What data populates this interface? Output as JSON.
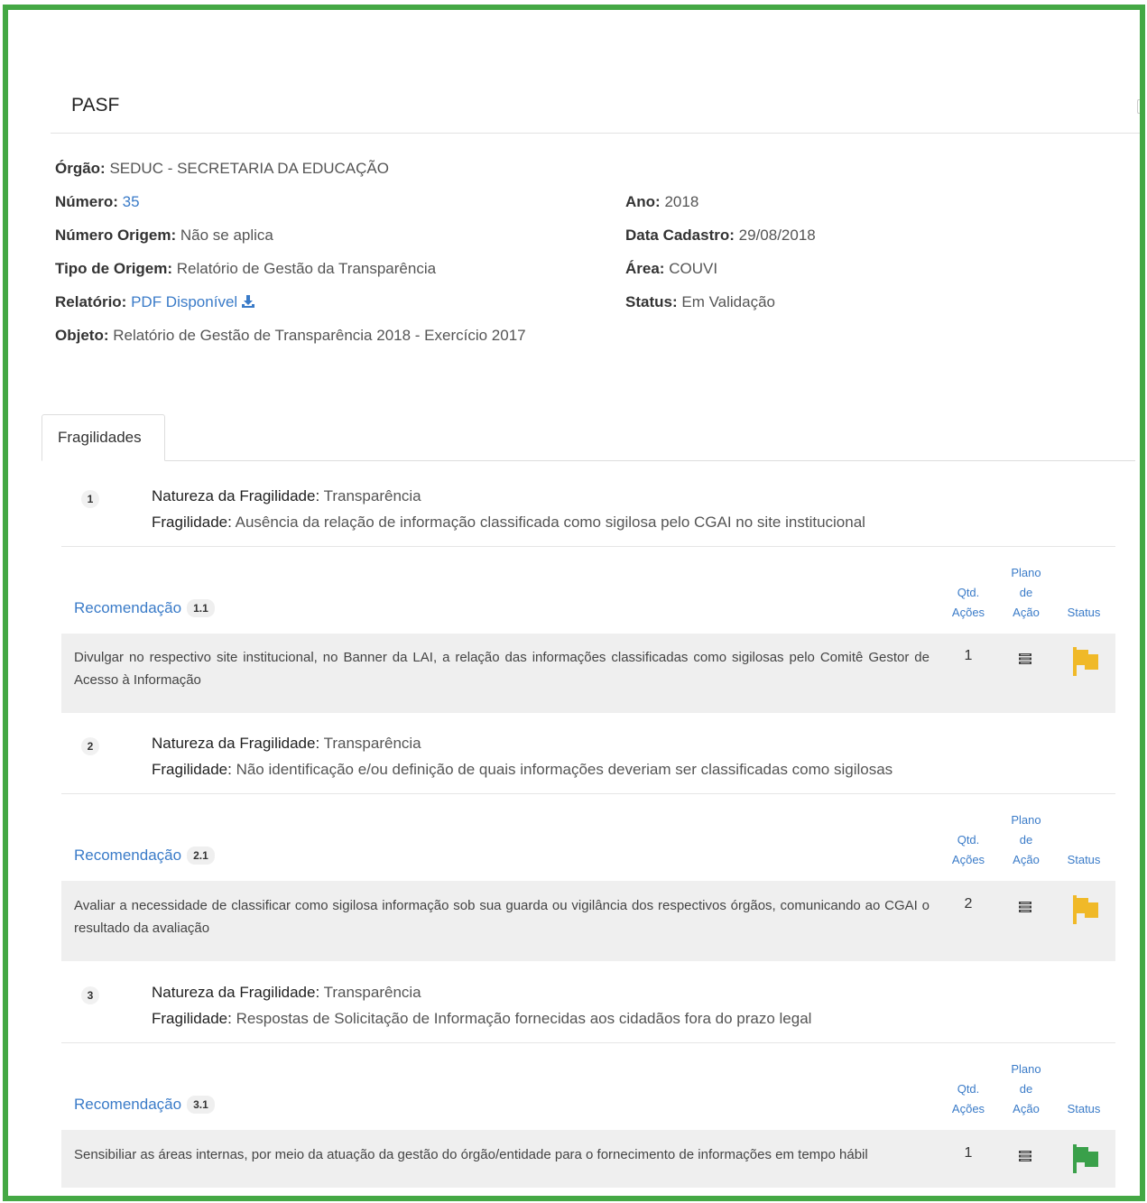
{
  "page": {
    "title": "PASF"
  },
  "info": {
    "orgao_label": "Órgão:",
    "orgao_value": "SEDUC - SECRETARIA DA EDUCAÇÃO",
    "numero_label": "Número:",
    "numero_value": "35",
    "numero_origem_label": "Número Origem:",
    "numero_origem_value": "Não se aplica",
    "tipo_origem_label": "Tipo de Origem:",
    "tipo_origem_value": "Relatório de Gestão da Transparência",
    "relatorio_label": "Relatório:",
    "relatorio_value": "PDF Disponível",
    "objeto_label": "Objeto:",
    "objeto_value": "Relatório de Gestão de Transparência 2018 - Exercício 2017",
    "ano_label": "Ano:",
    "ano_value": "2018",
    "data_cadastro_label": "Data Cadastro:",
    "data_cadastro_value": "29/08/2018",
    "area_label": "Área:",
    "area_value": "COUVI",
    "status_label": "Status:",
    "status_value": "Em Validação"
  },
  "tabs": {
    "fragilidades": "Fragilidades"
  },
  "labels": {
    "natureza": "Natureza da Fragilidade:",
    "fragilidade": "Fragilidade:",
    "recomendacao": "Recomendação",
    "col_qtd_1": "Qtd.",
    "col_qtd_2": "Ações",
    "col_plano_1": "Plano",
    "col_plano_2": "de",
    "col_plano_3": "Ação",
    "col_status": "Status"
  },
  "colors": {
    "accent": "#3a7bc8",
    "flag_pending": "#f0b928",
    "flag_done": "#3aa04a",
    "frame": "#44a844"
  },
  "fragilidades": [
    {
      "num": "1",
      "natureza": "Transparência",
      "descricao": "Ausência da relação de informação classificada como sigilosa pelo CGAI no site institucional",
      "recomendacao": {
        "num": "1.1",
        "texto": "Divulgar no respectivo site institucional, no Banner da LAI, a relação das informações classificadas como sigilosas pelo Comitê Gestor de Acesso à Informação",
        "qtd_acoes": "1",
        "status_icon": "flag-icon-yellow"
      }
    },
    {
      "num": "2",
      "natureza": "Transparência",
      "descricao": "Não identificação e/ou definição de quais informações deveriam ser classificadas como sigilosas",
      "recomendacao": {
        "num": "2.1",
        "texto": "Avaliar a necessidade de classificar como sigilosa informação sob sua guarda ou vigilância dos respectivos órgãos, comunicando ao CGAI o resultado da avaliação",
        "qtd_acoes": "2",
        "status_icon": "flag-icon-yellow"
      }
    },
    {
      "num": "3",
      "natureza": "Transparência",
      "descricao": "Respostas de Solicitação de Informação fornecidas aos cidadãos fora do prazo legal",
      "recomendacao": {
        "num": "3.1",
        "texto": "Sensibiliar as áreas internas, por meio da atuação da gestão do órgão/entidade para o fornecimento de informações em tempo hábil",
        "qtd_acoes": "1",
        "status_icon": "flag-icon-green"
      }
    }
  ]
}
